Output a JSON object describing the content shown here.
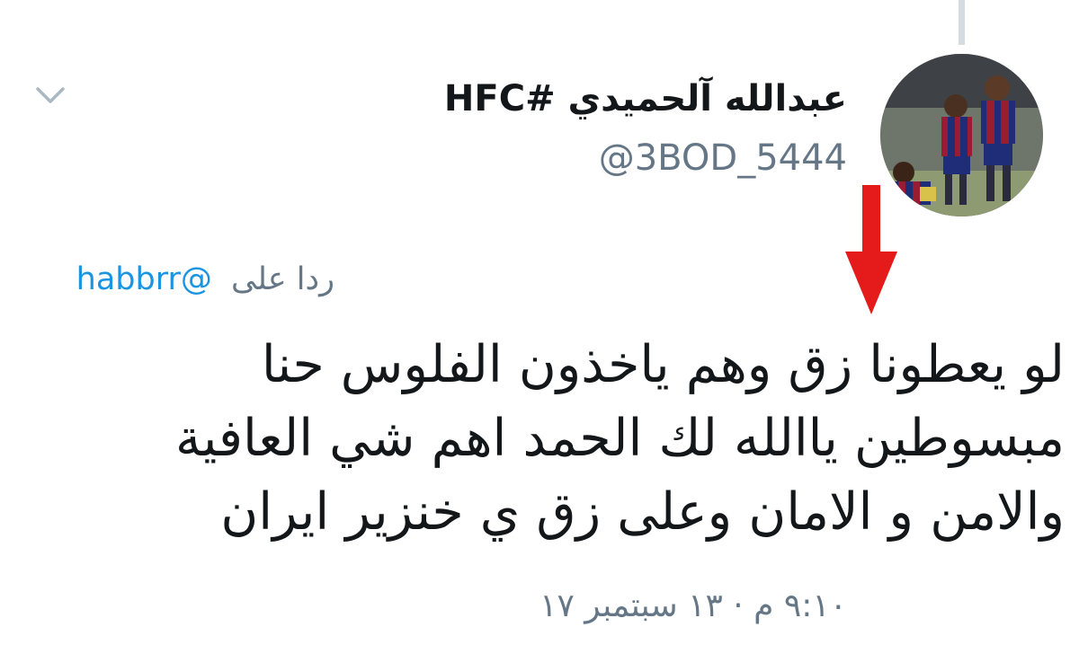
{
  "tweet": {
    "author": {
      "display_name": "عبدالله آلحميدي #HFC",
      "handle": "@3BOD_5444",
      "avatar_icon": "football-players-avatar"
    },
    "menu_icon": "chevron-down-icon",
    "annotation_icon": "red-arrow-down-icon",
    "reply": {
      "label": "ردا على",
      "mention": "@habbrr"
    },
    "text_lines": [
      "لو يعطونا زق وهم ياخذون الفلوس حنا",
      "مبسوطين ياالله لك الحمد اهم شي العافية",
      "والامن و الامان وعلى زق ي خنزير ايران"
    ],
    "timestamp": "٩:١٠ م · ١٣ سبتمبر ١٧"
  },
  "colors": {
    "text_primary": "#14171a",
    "text_secondary": "#657786",
    "link": "#1b95e0",
    "annotation_red": "#e51a1a",
    "thread_line": "#d6dbe1"
  }
}
